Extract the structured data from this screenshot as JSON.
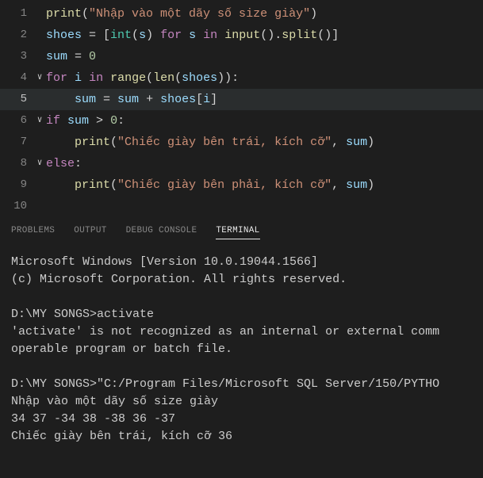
{
  "editor": {
    "lines": [
      {
        "n": "1",
        "fold": "",
        "tokens": [
          {
            "c": "fn",
            "t": "print"
          },
          {
            "c": "op",
            "t": "("
          },
          {
            "c": "str",
            "t": "\"Nhập vào một dãy số size giày\""
          },
          {
            "c": "op",
            "t": ")"
          }
        ]
      },
      {
        "n": "2",
        "fold": "",
        "tokens": [
          {
            "c": "var",
            "t": "shoes"
          },
          {
            "c": "op",
            "t": " = ["
          },
          {
            "c": "cls",
            "t": "int"
          },
          {
            "c": "op",
            "t": "("
          },
          {
            "c": "var",
            "t": "s"
          },
          {
            "c": "op",
            "t": ") "
          },
          {
            "c": "kw",
            "t": "for"
          },
          {
            "c": "op",
            "t": " "
          },
          {
            "c": "var",
            "t": "s"
          },
          {
            "c": "op",
            "t": " "
          },
          {
            "c": "kw",
            "t": "in"
          },
          {
            "c": "op",
            "t": " "
          },
          {
            "c": "fn",
            "t": "input"
          },
          {
            "c": "op",
            "t": "()."
          },
          {
            "c": "fn",
            "t": "split"
          },
          {
            "c": "op",
            "t": "()]"
          }
        ]
      },
      {
        "n": "3",
        "fold": "",
        "tokens": [
          {
            "c": "var",
            "t": "sum"
          },
          {
            "c": "op",
            "t": " = "
          },
          {
            "c": "num",
            "t": "0"
          }
        ]
      },
      {
        "n": "4",
        "fold": "∨",
        "tokens": [
          {
            "c": "kw",
            "t": "for"
          },
          {
            "c": "op",
            "t": " "
          },
          {
            "c": "var",
            "t": "i"
          },
          {
            "c": "op",
            "t": " "
          },
          {
            "c": "kw",
            "t": "in"
          },
          {
            "c": "op",
            "t": " "
          },
          {
            "c": "fn",
            "t": "range"
          },
          {
            "c": "op",
            "t": "("
          },
          {
            "c": "fn",
            "t": "len"
          },
          {
            "c": "op",
            "t": "("
          },
          {
            "c": "var",
            "t": "shoes"
          },
          {
            "c": "op",
            "t": ")):"
          }
        ]
      },
      {
        "n": "5",
        "fold": "",
        "current": true,
        "indent": "    ",
        "tokens": [
          {
            "c": "var",
            "t": "sum"
          },
          {
            "c": "op",
            "t": " = "
          },
          {
            "c": "var",
            "t": "sum"
          },
          {
            "c": "op",
            "t": " + "
          },
          {
            "c": "var",
            "t": "shoes"
          },
          {
            "c": "op",
            "t": "["
          },
          {
            "c": "var",
            "t": "i"
          },
          {
            "c": "op",
            "t": "]"
          }
        ]
      },
      {
        "n": "6",
        "fold": "∨",
        "tokens": [
          {
            "c": "kw",
            "t": "if"
          },
          {
            "c": "op",
            "t": " "
          },
          {
            "c": "var",
            "t": "sum"
          },
          {
            "c": "op",
            "t": " > "
          },
          {
            "c": "num",
            "t": "0"
          },
          {
            "c": "op",
            "t": ":"
          }
        ]
      },
      {
        "n": "7",
        "fold": "",
        "indent": "    ",
        "tokens": [
          {
            "c": "fn",
            "t": "print"
          },
          {
            "c": "op",
            "t": "("
          },
          {
            "c": "str",
            "t": "\"Chiếc giày bên trái, kích cỡ\""
          },
          {
            "c": "op",
            "t": ", "
          },
          {
            "c": "var",
            "t": "sum"
          },
          {
            "c": "op",
            "t": ")"
          }
        ]
      },
      {
        "n": "8",
        "fold": "∨",
        "tokens": [
          {
            "c": "kw",
            "t": "else"
          },
          {
            "c": "op",
            "t": ":"
          }
        ]
      },
      {
        "n": "9",
        "fold": "",
        "indent": "    ",
        "tokens": [
          {
            "c": "fn",
            "t": "print"
          },
          {
            "c": "op",
            "t": "("
          },
          {
            "c": "str",
            "t": "\"Chiếc giày bên phải, kích cỡ\""
          },
          {
            "c": "op",
            "t": ", "
          },
          {
            "c": "var",
            "t": "sum"
          },
          {
            "c": "op",
            "t": ")"
          }
        ]
      },
      {
        "n": "10",
        "fold": "",
        "tokens": []
      }
    ]
  },
  "panel": {
    "tabs": [
      "PROBLEMS",
      "OUTPUT",
      "DEBUG CONSOLE",
      "TERMINAL"
    ],
    "active": 3
  },
  "terminal": {
    "lines": [
      "Microsoft Windows [Version 10.0.19044.1566]",
      "(c) Microsoft Corporation. All rights reserved.",
      "",
      "D:\\MY SONGS>activate",
      "'activate' is not recognized as an internal or external comm",
      "operable program or batch file.",
      "",
      "D:\\MY SONGS>\"C:/Program Files/Microsoft SQL Server/150/PYTHO",
      "Nhập vào một dãy số size giày",
      "34 37 -34 38 -38 36 -37",
      "Chiếc giày bên trái, kích cỡ 36"
    ]
  }
}
